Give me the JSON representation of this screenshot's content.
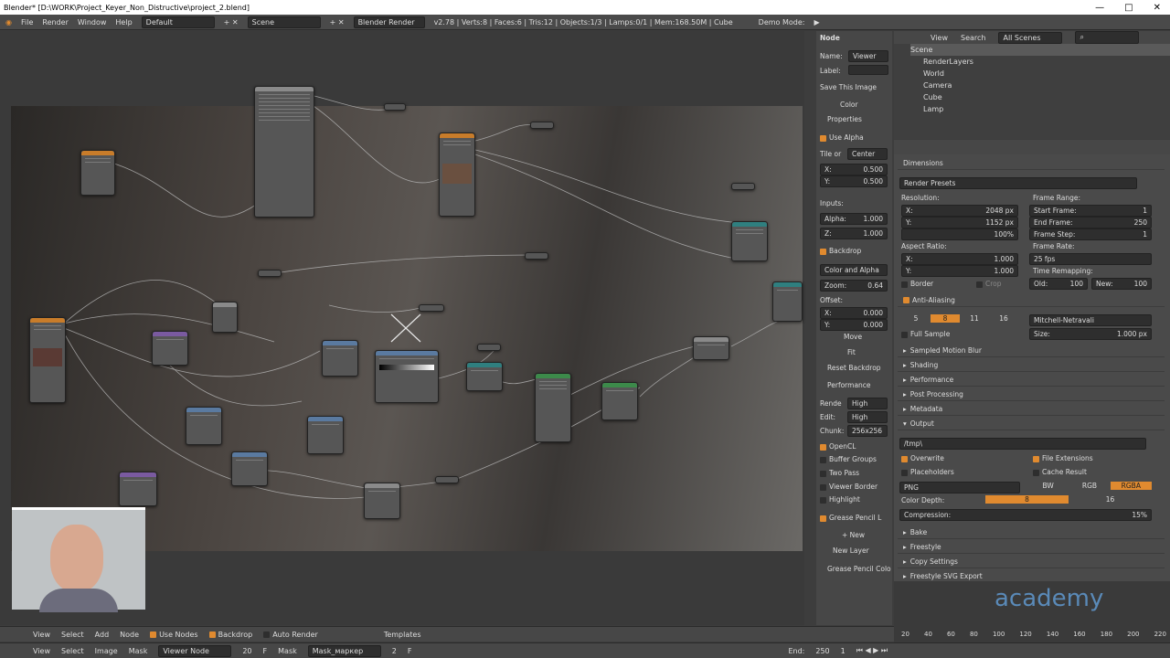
{
  "titlebar": {
    "title": "Blender* [D:\\WORK\\Project_Keyer_Non_Distructive\\project_2.blend]",
    "minimize": "—",
    "maximize": "□",
    "close": "✕"
  },
  "infobar": {
    "menus": [
      "File",
      "Render",
      "Window",
      "Help"
    ],
    "layout": "Default",
    "scene": "Scene",
    "engine": "Blender Render",
    "stats": "v2.78 | Verts:8 | Faces:6 | Tris:12 | Objects:1/3 | Lamps:0/1 | Mem:168.50M | Cube",
    "mode": "Demo Mode:"
  },
  "npanel": {
    "node_header": "Node",
    "name_label": "Name:",
    "name_value": "Viewer",
    "label_label": "Label:",
    "save_image": "Save This Image",
    "color": "Color",
    "properties": "Properties",
    "use_alpha": "Use Alpha",
    "tile_origin": "Tile or",
    "tile_value": "Center",
    "x_label": "X:",
    "x_value": "0.500",
    "y_label": "Y:",
    "y_value": "0.500",
    "inputs": "Inputs:",
    "alpha_label": "Alpha:",
    "alpha_value": "1.000",
    "z_label": "Z:",
    "z_value": "1.000",
    "backdrop": "Backdrop",
    "color_alpha": "Color and Alpha",
    "zoom_label": "Zoom:",
    "zoom_value": "0.64",
    "offset": "Offset:",
    "ox_label": "X:",
    "ox_value": "0.000",
    "oy_label": "Y:",
    "oy_value": "0.000",
    "move": "Move",
    "fit": "Fit",
    "reset_backdrop": "Reset Backdrop",
    "performance": "Performance",
    "render_label": "Rende",
    "render_value": "High",
    "edit_label": "Edit:",
    "edit_value": "High",
    "chunk_label": "Chunk:",
    "chunk_value": "256x256",
    "opencl": "OpenCL",
    "buffer_groups": "Buffer Groups",
    "two_pass": "Two Pass",
    "viewer_border": "Viewer Border",
    "highlight": "Highlight",
    "grease_pencil": "Grease Pencil L",
    "new": "New",
    "new_layer": "New Layer",
    "grease_pencil_col": "Grease Pencil Colo"
  },
  "outliner": {
    "view": "View",
    "search": "Search",
    "scenes": "All Scenes",
    "items": [
      "Scene",
      "RenderLayers",
      "World",
      "Camera",
      "Cube",
      "Lamp"
    ]
  },
  "props": {
    "dimensions": "Dimensions",
    "render_presets": "Render Presets",
    "resolution": "Resolution:",
    "res_x_label": "X:",
    "res_x": "2048 px",
    "res_y_label": "Y:",
    "res_y": "1152 px",
    "res_pct": "100%",
    "frame_range": "Frame Range:",
    "start_frame_label": "Start Frame:",
    "start_frame": "1",
    "end_frame_label": "End Frame:",
    "end_frame": "250",
    "frame_step_label": "Frame Step:",
    "frame_step": "1",
    "aspect_ratio": "Aspect Ratio:",
    "asp_x_label": "X:",
    "asp_x": "1.000",
    "asp_y_label": "Y:",
    "asp_y": "1.000",
    "frame_rate": "Frame Rate:",
    "fps": "25 fps",
    "time_remap": "Time Remapping:",
    "old_label": "Old:",
    "old": "100",
    "new_label": "New:",
    "new": "100",
    "border": "Border",
    "crop": "Crop",
    "anti_aliasing": "Anti-Aliasing",
    "aa_values": [
      "5",
      "8",
      "11",
      "16"
    ],
    "aa_filter": "Mitchell-Netravali",
    "full_sample": "Full Sample",
    "size_label": "Size:",
    "size": "1.000 px",
    "sections": [
      "Sampled Motion Blur",
      "Shading",
      "Performance",
      "Post Processing",
      "Metadata",
      "Output"
    ],
    "output_path": "/tmp\\",
    "overwrite": "Overwrite",
    "file_ext": "File Extensions",
    "placeholders": "Placeholders",
    "cache": "Cache Result",
    "format": "PNG",
    "bw": "BW",
    "rgb": "RGB",
    "rgba": "RGBA",
    "color_depth": "Color Depth:",
    "depth8": "8",
    "depth16": "16",
    "compression": "Compression:",
    "compression_val": "15%",
    "bake": "Bake",
    "freestyle": "Freestyle",
    "copy_settings": "Copy Settings",
    "freestyle_svg": "Freestyle SVG Export"
  },
  "timeline": {
    "ticks": [
      "20",
      "40",
      "60",
      "80",
      "100",
      "120",
      "140",
      "160",
      "180",
      "200",
      "220"
    ],
    "end_label": "End:",
    "end": "250",
    "current": "1",
    "watermark": "academy"
  },
  "bottom1": {
    "items": [
      "View",
      "Select",
      "Add",
      "Node",
      "Use Nodes",
      "Backdrop",
      "Auto Render",
      "Templates"
    ]
  },
  "bottom2": {
    "items": [
      "View",
      "Select",
      "Image",
      "Mask",
      "Viewer Node",
      "20",
      "F",
      "Mask",
      "Mask_маркер",
      "2",
      "F"
    ]
  },
  "colors": {
    "accent": "#e08a2f",
    "node_header_green": "#3c8a4a",
    "node_header_orange": "#c87c2a",
    "node_header_teal": "#2f7f7f"
  }
}
